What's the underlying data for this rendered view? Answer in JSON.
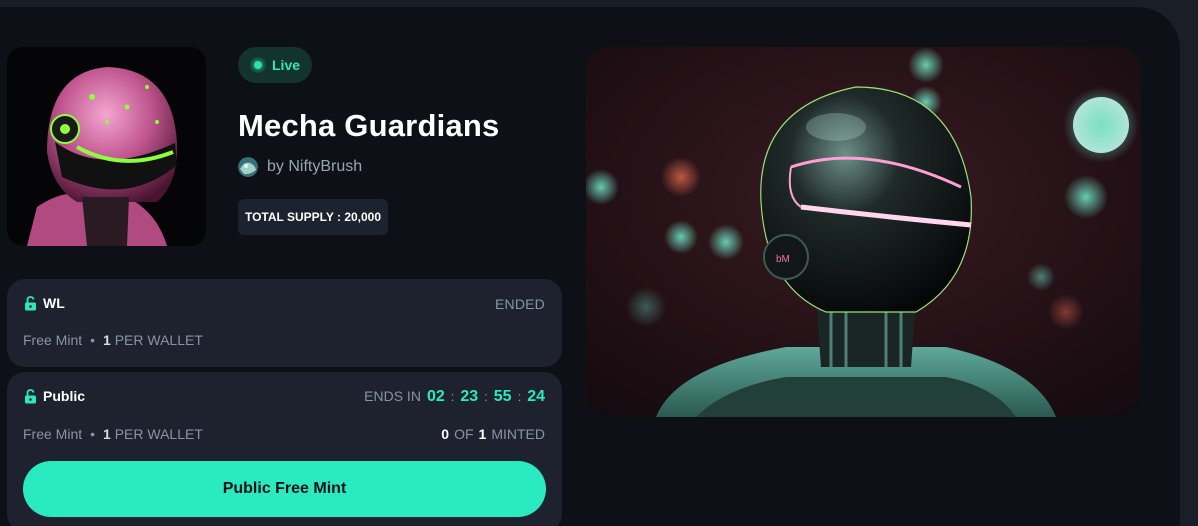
{
  "collection": {
    "status": "Live",
    "title": "Mecha Guardians",
    "creator": "by NiftyBrush",
    "total_supply": "TOTAL SUPPLY : 20,000"
  },
  "phases": [
    {
      "name": "WL",
      "status": "ENDED",
      "price": "Free Mint",
      "limit_count": "1",
      "limit_label": "PER WALLET"
    },
    {
      "name": "Public",
      "ends_label": "ENDS IN",
      "countdown": [
        "02",
        "23",
        "55",
        "24"
      ],
      "price": "Free Mint",
      "limit_count": "1",
      "limit_label": "PER WALLET",
      "minted_count": "0",
      "minted_of": "OF",
      "minted_total": "1",
      "minted_label": "MINTED",
      "button_label": "Public Free Mint"
    }
  ],
  "bullet": "•",
  "countdown_separator": ":",
  "icons": {
    "lock": "unlock-icon",
    "live_dot": "live-dot-icon",
    "creator_avatar": "creator-avatar"
  },
  "colors": {
    "accent": "#2aeac2",
    "background": "#0d1117",
    "card": "#1e222e",
    "muted_text": "#8a93a6"
  }
}
